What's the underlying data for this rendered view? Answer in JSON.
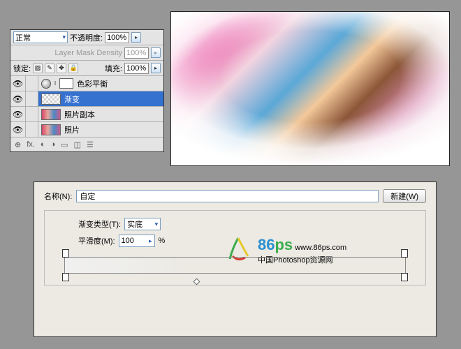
{
  "layers_panel": {
    "blend_mode": "正常",
    "opacity_label": "不透明度:",
    "opacity_value": "100%",
    "mask_density_label": "Layer Mask Density",
    "mask_density_value": "100%",
    "lock_label": "锁定:",
    "fill_label": "填充:",
    "fill_value": "100%",
    "layers": [
      {
        "name": "色彩平衡",
        "visible": true,
        "type": "adjustment"
      },
      {
        "name": "渐变",
        "visible": true,
        "type": "gradient",
        "selected": true
      },
      {
        "name": "照片副本",
        "visible": true,
        "type": "image"
      },
      {
        "name": "照片",
        "visible": true,
        "type": "image"
      }
    ],
    "foot_icons": [
      "⊕",
      "fx.",
      "◐",
      "◑",
      "▭",
      "◫",
      "☰"
    ]
  },
  "gradient_dialog": {
    "name_label": "名称(N):",
    "name_value": "自定",
    "new_button": "新建(W)",
    "type_label": "渐变类型(T):",
    "type_value": "实底",
    "smooth_label": "平滑度(M):",
    "smooth_value": "100",
    "smooth_unit": "%"
  },
  "watermark": {
    "brand_num": "86",
    "brand_suffix": "ps",
    "url": "www.86ps.com",
    "tagline": "中国Photoshop资源网"
  }
}
